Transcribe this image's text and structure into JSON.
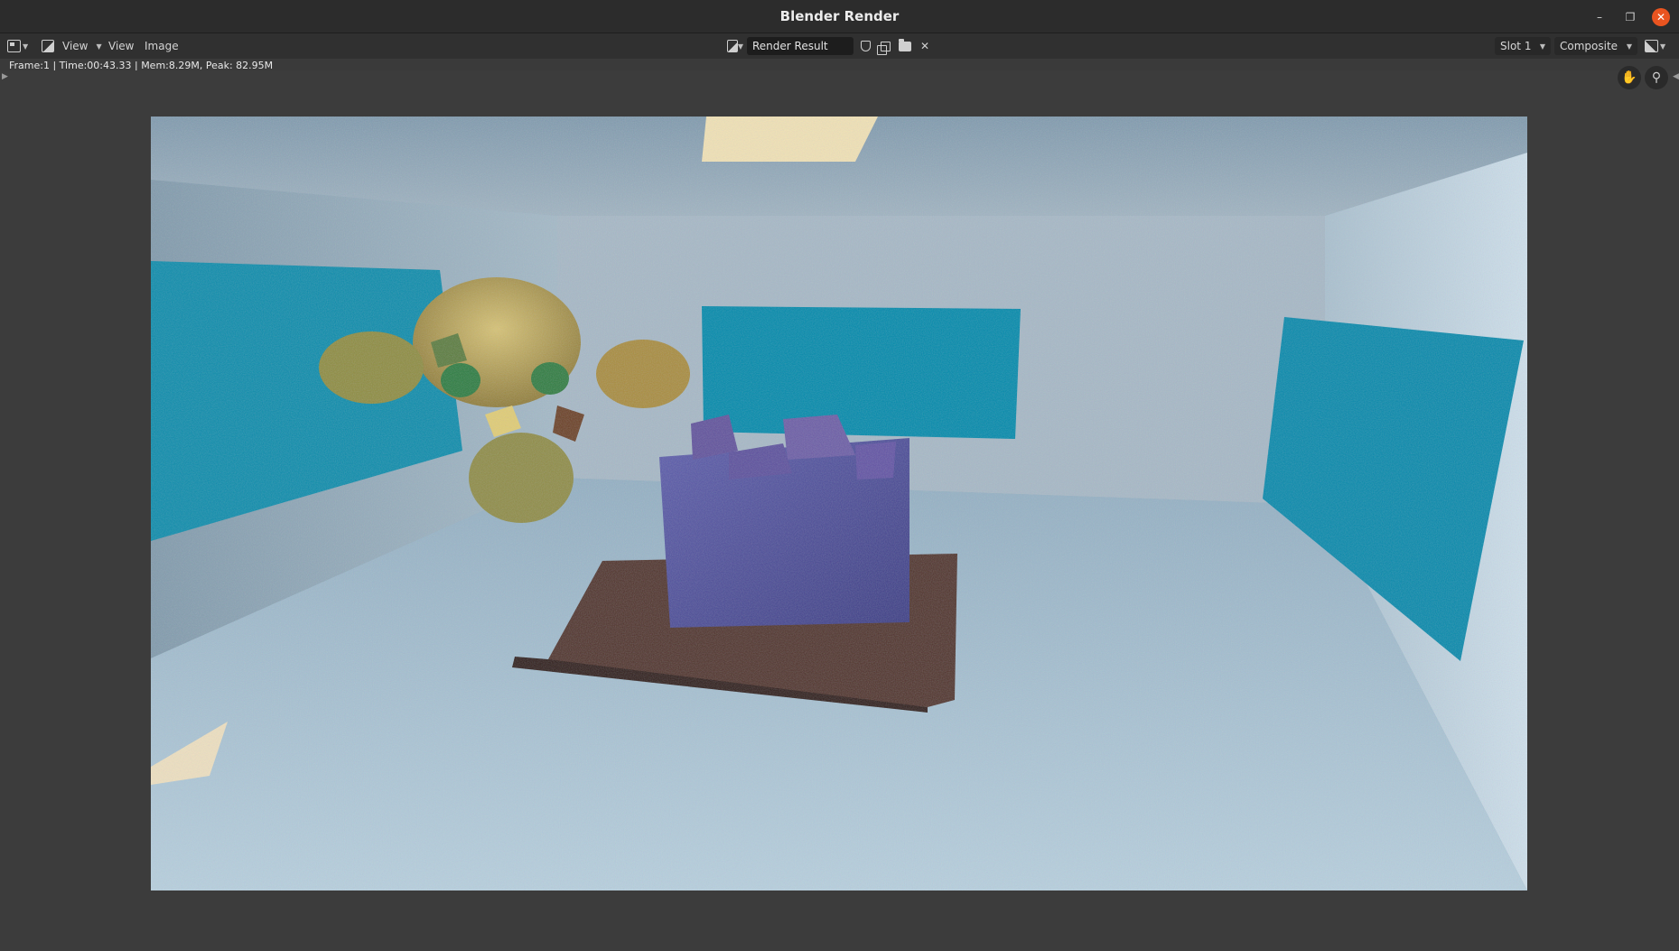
{
  "window": {
    "title": "Blender Render",
    "minimize_icon": "minimize-icon",
    "maximize_icon": "restore-icon",
    "close_icon": "close-icon"
  },
  "header": {
    "editor_type_icon": "image-editor-icon",
    "view_dropdown_label": "View",
    "menus": [
      "View",
      "Image"
    ],
    "image_name": "Render Result",
    "tools": [
      "fake-user-shield-icon",
      "duplicate-image-icon",
      "open-folder-icon",
      "unlink-x-icon"
    ],
    "slot": "Slot 1",
    "pass": "Composite",
    "display_mode_icon": "display-channels-icon"
  },
  "status": {
    "text": "Frame:1 | Time:00:43.33 | Mem:8.29M, Peak: 82.95M"
  },
  "viewport": {
    "gizmos": [
      "pan-hand-icon",
      "zoom-magnifier-icon"
    ]
  },
  "colors": {
    "accent_close": "#e95420",
    "panel_accent": "#0085a6",
    "floor_plate": "#5a3a30",
    "cube": "#4a4a98",
    "monkey_gold": "#b39a48",
    "monkey_green": "#2b7a3c"
  }
}
